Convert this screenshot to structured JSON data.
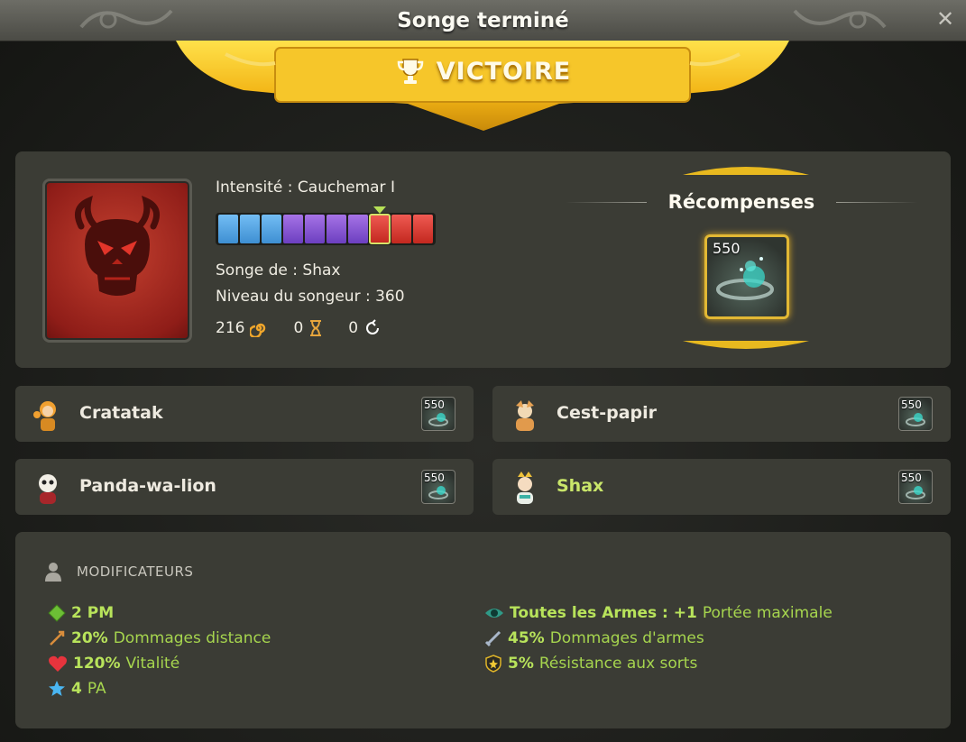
{
  "window": {
    "title": "Songe terminé",
    "close_icon": "close-icon"
  },
  "banner": {
    "label": "VICTOIRE",
    "icon": "trophy-icon",
    "color": "#f2c21d"
  },
  "dream": {
    "intensity": "Intensité : Cauchemar I",
    "intensity_bar": {
      "segments": [
        "blue",
        "blue",
        "blue",
        "purple",
        "purple",
        "purple",
        "purple",
        "red",
        "red",
        "red"
      ],
      "current_index": 7
    },
    "dreamer": "Songe de : Shax",
    "dreamer_level": "Niveau du songeur : 360",
    "stats": [
      {
        "value": "216",
        "icon": "spiral-icon",
        "color": "#f0a62b"
      },
      {
        "value": "0",
        "icon": "hourglass-icon",
        "color": "#e7a53c"
      },
      {
        "value": "0",
        "icon": "refresh-icon",
        "color": "#ffffff"
      }
    ]
  },
  "rewards": {
    "title": "Récompenses",
    "item": {
      "quantity": "550",
      "icon": "dream-orb-icon"
    }
  },
  "players": [
    {
      "name": "Cratatak",
      "reward_qty": "550",
      "highlight": false
    },
    {
      "name": "Cest-papir",
      "reward_qty": "550",
      "highlight": false
    },
    {
      "name": "Panda-wa-lion",
      "reward_qty": "550",
      "highlight": false
    },
    {
      "name": "Shax",
      "reward_qty": "550",
      "highlight": true
    }
  ],
  "modifiers": {
    "title": "MODIFICATEURS",
    "left": [
      {
        "value": "2 PM",
        "text": "",
        "icon": "green-diamond-icon"
      },
      {
        "value": "20%",
        "text": "Dommages distance",
        "icon": "bow-icon"
      },
      {
        "value": "120%",
        "text": "Vitalité",
        "icon": "heart-icon"
      },
      {
        "value": "4",
        "text": "PA",
        "icon": "blue-star-icon"
      }
    ],
    "right": [
      {
        "value": "Toutes les Armes : +1",
        "text": "Portée maximale",
        "icon": "eye-icon"
      },
      {
        "value": "45%",
        "text": "Dommages d'armes",
        "icon": "sword-icon"
      },
      {
        "value": "5%",
        "text": "Résistance aux sorts",
        "icon": "shield-icon"
      }
    ]
  }
}
